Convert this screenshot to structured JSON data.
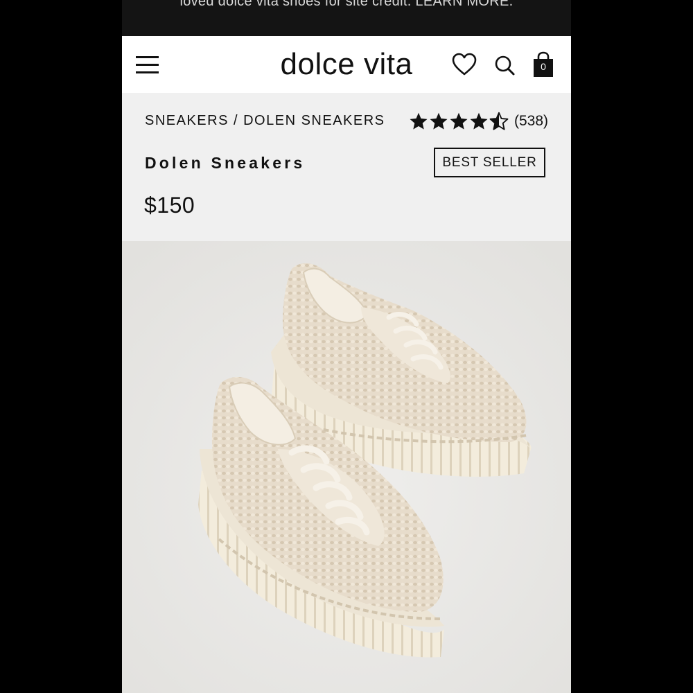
{
  "promo": {
    "text": "loved dolce vita shoes for site credit. LEARN MORE."
  },
  "header": {
    "brand": "dolce vita",
    "cart_count": "0",
    "icons": [
      "menu-icon",
      "heart-icon",
      "search-icon",
      "shopping-bag-icon"
    ]
  },
  "product": {
    "breadcrumb": {
      "category": "SNEAKERS",
      "separator": " / ",
      "current": "DOLEN SNEAKERS"
    },
    "rating": {
      "stars": 4.5,
      "max": 5,
      "count_label": "(538)"
    },
    "title": "Dolen Sneakers",
    "badge": "BEST SELLER",
    "price": "$150"
  },
  "colors": {
    "background": "#f0f0f0",
    "promo_bar": "#141414",
    "text": "#111111",
    "photo_background": "#e9e8e6",
    "shoe_upper": "#e6dac8",
    "shoe_sole": "#f1ead8"
  }
}
